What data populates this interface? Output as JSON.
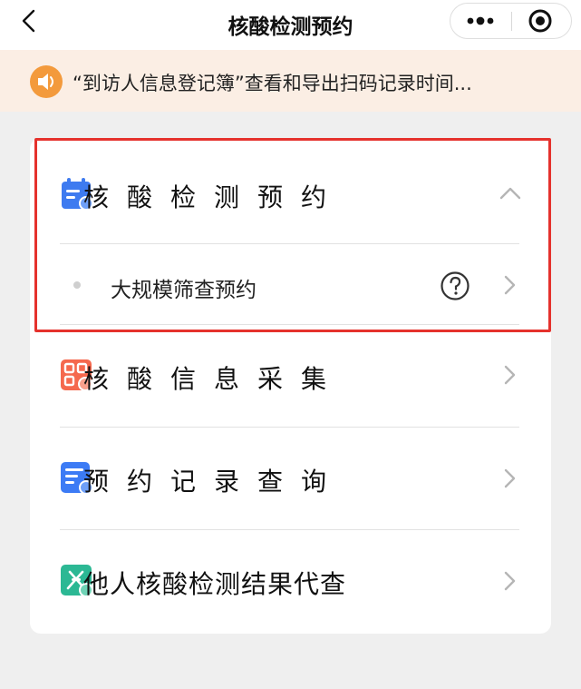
{
  "nav": {
    "title": "核酸检测预约"
  },
  "notice": {
    "text": "“到访人信息登记簿”查看和导出扫码记录时间..."
  },
  "menu": {
    "nucleic_booking": "核酸检测预约",
    "sub_item": "大规模筛查预约",
    "info_collect": "核酸信息采集",
    "booking_records": "预约记录查询",
    "proxy_query": "他人核酸检测结果代查"
  },
  "colors": {
    "accent_orange": "#f39a3c",
    "calendar_blue": "#3e7bf0",
    "qr_orange": "#f5694e",
    "records_blue": "#3c7bf5",
    "proxy_green": "#2cb894",
    "highlight_red": "#e5322d"
  },
  "icons": {
    "back": "chevron-left-icon",
    "more": "more-dots-icon",
    "close": "target-close-icon",
    "notice": "speaker-icon",
    "booking": "calendar-icon",
    "collect": "qr-code-icon",
    "records": "document-search-icon",
    "proxy": "dna-search-icon",
    "help": "question-icon",
    "expand": "chevron-up-icon",
    "arrow": "chevron-right-icon"
  }
}
